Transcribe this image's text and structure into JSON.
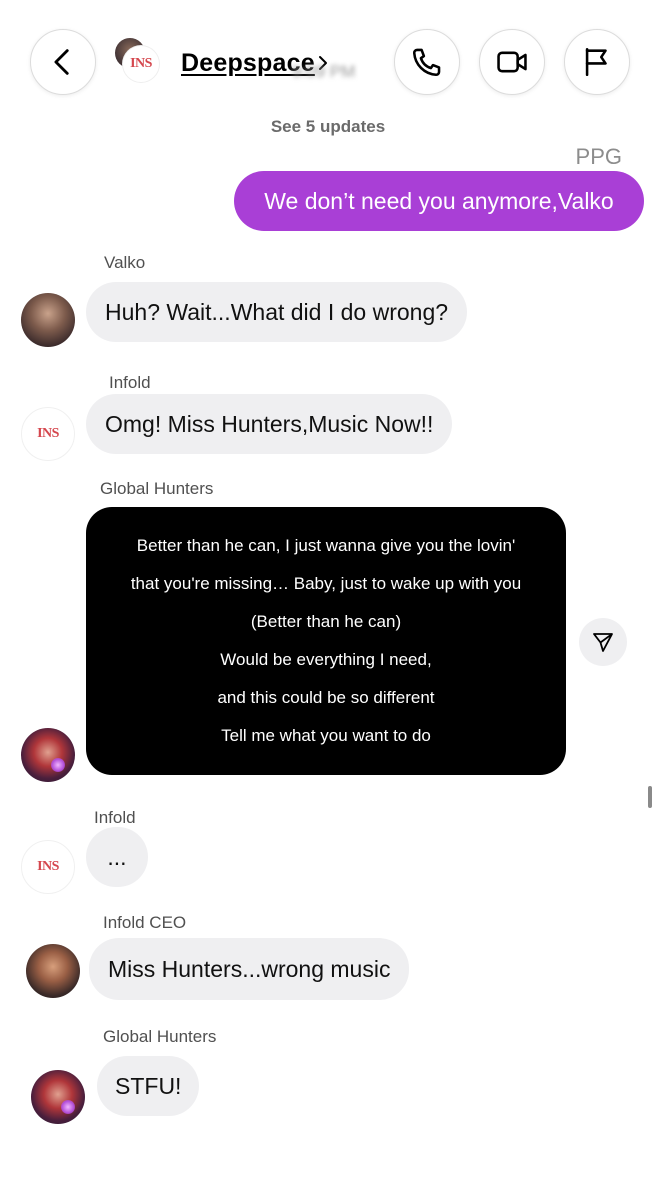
{
  "header": {
    "title": "Deepspace",
    "blurred_time": "9:09 PM",
    "updates_link": "See 5 updates",
    "group_logo_text": "INS"
  },
  "messages": [
    {
      "sender": "PPG",
      "text": "We don’t need you anymore,Valko",
      "outgoing": true
    },
    {
      "sender": "Valko",
      "text": "Huh? Wait...What did I do wrong?"
    },
    {
      "sender": "Infold",
      "text": "Omg! Miss Hunters,Music Now!!"
    },
    {
      "sender": "Global Hunters",
      "lyrics": [
        "Better than he can, I just wanna give you the lovin'",
        "that you're missing… Baby, just to wake up with you",
        "(Better than he can)",
        "Would be everything I need,",
        "and this could be so different",
        "Tell me what you want to do"
      ]
    },
    {
      "sender": "Infold",
      "text": "..."
    },
    {
      "sender": "Infold CEO",
      "text": "Miss Hunters...wrong music"
    },
    {
      "sender": "Global Hunters",
      "text": "STFU!"
    }
  ],
  "icons": {
    "back": "chevron-left-icon",
    "call": "phone-icon",
    "video": "video-camera-icon",
    "flag": "flag-icon",
    "share": "send-icon"
  },
  "colors": {
    "outgoing_bubble": "#a93fd6",
    "incoming_bubble": "#efeff1",
    "lyrics_card": "#000000"
  }
}
